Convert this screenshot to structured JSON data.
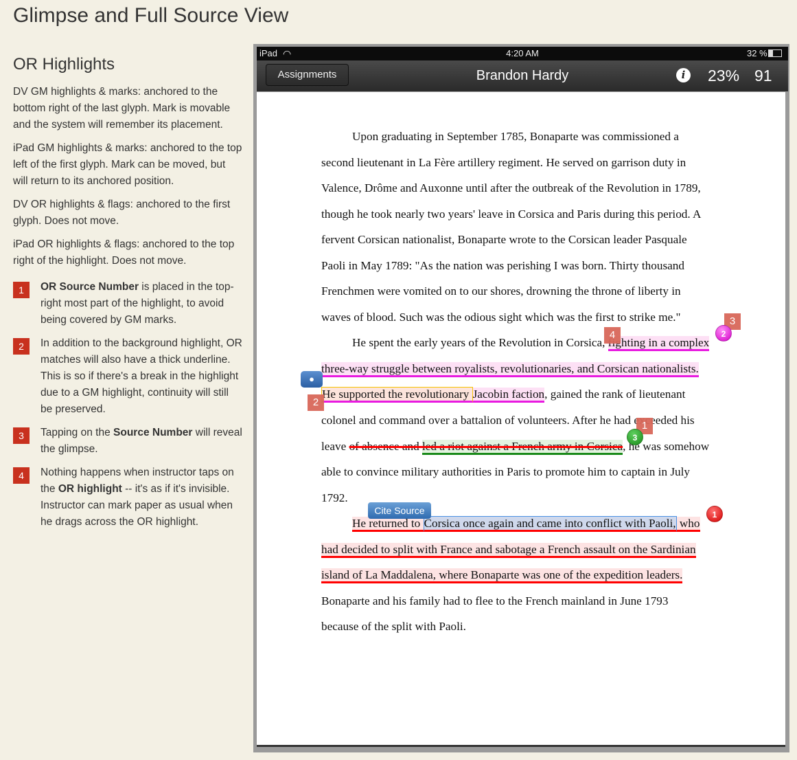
{
  "title": "Glimpse and Full Source View",
  "sidebar": {
    "heading": "OR Highlights",
    "paragraphs": [
      "DV GM highlights & marks: anchored to the bottom right of the last glyph. Mark is movable and the system will remember its placement.",
      "iPad GM highlights & marks: anchored to the top left of the first glyph. Mark can be moved, but will return to its anchored position.",
      "DV OR highlights & flags: anchored to the first glyph. Does not move.",
      "iPad OR highlights & flags: anchored to the top right of the highlight. Does not move."
    ],
    "items": [
      {
        "num": "1",
        "pre": "",
        "bold": "OR Source Number",
        "post": " is placed in the top-right most part of the highlight, to avoid being covered by GM marks."
      },
      {
        "num": "2",
        "pre": "In addition to the background highlight, OR matches will also have a thick underline. This is so if there's a break in the highlight due to a GM highlight, continuity will still be preserved.",
        "bold": "",
        "post": ""
      },
      {
        "num": "3",
        "pre": "Tapping on the ",
        "bold": "Source Number",
        "post": " will reveal the glimpse."
      },
      {
        "num": "4",
        "pre": "Nothing happens when instructor taps on the ",
        "bold": "OR highlight",
        "post": " -- it's as if it's invisible. Instructor can mark paper as usual when he drags across the OR highlight."
      }
    ]
  },
  "device": {
    "status": {
      "device": "iPad",
      "time": "4:20 AM",
      "battery": "32 %"
    },
    "nav": {
      "back_button": "Assignments",
      "student": "Brandon Hardy",
      "info_icon": "info-icon",
      "percent": "23%",
      "score": "91"
    },
    "cite_button": "Cite Source",
    "comment_icon": "speech-bubble-icon",
    "marks": {
      "gm_4": "4",
      "gm_3": "3",
      "gm_2": "2",
      "gm_1": "1",
      "or_2": "2",
      "or_3": "3",
      "or_1": "1"
    },
    "colors": {
      "or_pink": "#e81ae0",
      "or_green": "#1a8a1a",
      "or_red": "#ff0000",
      "gm_mark": "#d9685a"
    }
  },
  "lines": [
    {
      "indent": true,
      "segs": [
        {
          "s": "",
          "t": "Upon graduating in September 1785, Bonaparte was commissioned a"
        }
      ]
    },
    {
      "segs": [
        {
          "s": "",
          "t": "second lieutenant in La Fère artillery regiment. He served on garrison duty in"
        }
      ]
    },
    {
      "segs": [
        {
          "s": "",
          "t": "Valence, Drôme and Auxonne until after the outbreak of the Revolution in 1789,"
        }
      ]
    },
    {
      "segs": [
        {
          "s": "",
          "t": "though he took nearly two years' leave in Corsica and Paris during this period. A"
        }
      ]
    },
    {
      "segs": [
        {
          "s": "",
          "t": "fervent Corsican nationalist, Bonaparte wrote to the Corsican leader Pasquale"
        }
      ]
    },
    {
      "segs": [
        {
          "s": "",
          "t": "Paoli in May 1789: \"As the nation was perishing I was born. Thirty thousand"
        }
      ]
    },
    {
      "segs": [
        {
          "s": "",
          "t": "Frenchmen were vomited on to our shores, drowning the throne of liberty in"
        }
      ]
    },
    {
      "segs": [
        {
          "s": "",
          "t": "waves of blood. Such was the odious sight which was the first to strike me.\""
        }
      ]
    },
    {
      "indent": true,
      "segs": [
        {
          "s": "",
          "t": "He spent the early years of the Revolution in Corsica, "
        },
        {
          "s": "pink",
          "t": "fighting in a complex"
        }
      ]
    },
    {
      "segs": [
        {
          "s": "pink",
          "t": "three-way struggle between royalists, revolutionaries, and Corsican nationalists."
        }
      ]
    },
    {
      "segs": [
        {
          "s": "yellow",
          "t": "He supported the revolutionary "
        },
        {
          "s": "pink",
          "t": "Jacobin faction"
        },
        {
          "s": "",
          "t": ", gained the rank of lieutenant"
        }
      ]
    },
    {
      "segs": [
        {
          "s": "",
          "t": "colonel and command over a battalion of volunteers. After he had exceeded his"
        }
      ]
    },
    {
      "segs": [
        {
          "s": "",
          "t": "leave "
        },
        {
          "s": "strike",
          "t": "of absence and "
        },
        {
          "s": "green",
          "t": "led a riot against a French army in Corsica"
        },
        {
          "s": "",
          "t": ", he was somehow"
        }
      ]
    },
    {
      "segs": [
        {
          "s": "",
          "t": "able to convince military authorities in Paris to promote him to captain in July"
        }
      ]
    },
    {
      "segs": [
        {
          "s": "",
          "t": "1792."
        }
      ]
    },
    {
      "indent": true,
      "segs": [
        {
          "s": "red",
          "t": "He returned to "
        },
        {
          "s": "blue",
          "t": "Corsica once again and came into conflict with Paoli,"
        },
        {
          "s": "red",
          "t": " who"
        }
      ]
    },
    {
      "segs": [
        {
          "s": "red",
          "t": "had decided to split with France and sabotage a French assault on the Sardinian"
        }
      ]
    },
    {
      "segs": [
        {
          "s": "red",
          "t": "island of La Maddalena, where Bonaparte was one of the expedition leaders."
        }
      ]
    },
    {
      "segs": [
        {
          "s": "",
          "t": "Bonaparte and his family had to flee to the French mainland in June 1793"
        }
      ]
    },
    {
      "segs": [
        {
          "s": "",
          "t": "because of the split with Paoli."
        }
      ]
    }
  ]
}
